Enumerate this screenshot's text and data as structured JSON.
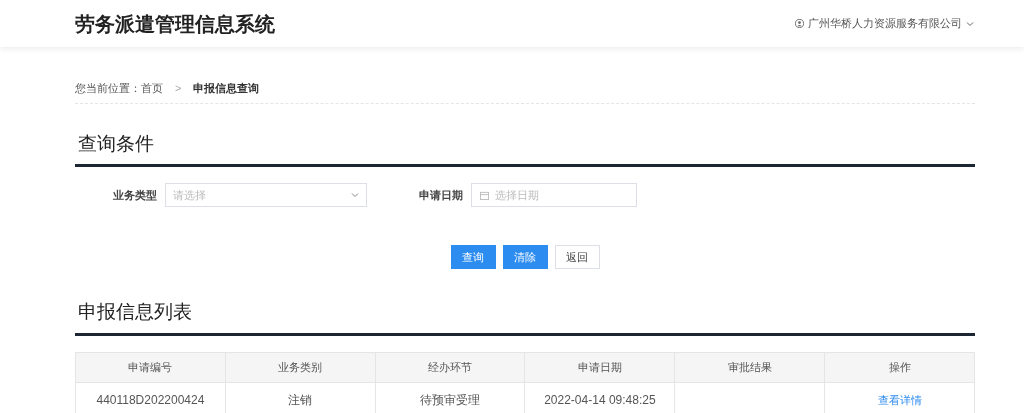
{
  "header": {
    "title": "劳务派遣管理信息系统",
    "company": "广州华桥人力资源服务有限公司"
  },
  "breadcrumb": {
    "label": "您当前位置：",
    "items": [
      "首页",
      "申报信息查询"
    ],
    "separator": ">"
  },
  "query": {
    "title": "查询条件",
    "fields": [
      {
        "kind": "select",
        "label": "业务类型",
        "placeholder": "请选择"
      },
      {
        "kind": "date",
        "label": "申请日期",
        "placeholder": "选择日期"
      }
    ],
    "buttons": [
      {
        "label": "查询",
        "kind": "primary"
      },
      {
        "label": "清除",
        "kind": "primary"
      },
      {
        "label": "返回",
        "kind": "plain"
      }
    ]
  },
  "list": {
    "title": "申报信息列表",
    "table": {
      "columns": [
        "申请编号",
        "业务类别",
        "经办环节",
        "申请日期",
        "审批结果",
        "操作"
      ],
      "rows": [
        {
          "cells": [
            "440118D202200424",
            "注销",
            "待预审受理",
            "2022-04-14 09:48:25",
            ""
          ],
          "action": "查看详情"
        }
      ]
    }
  }
}
